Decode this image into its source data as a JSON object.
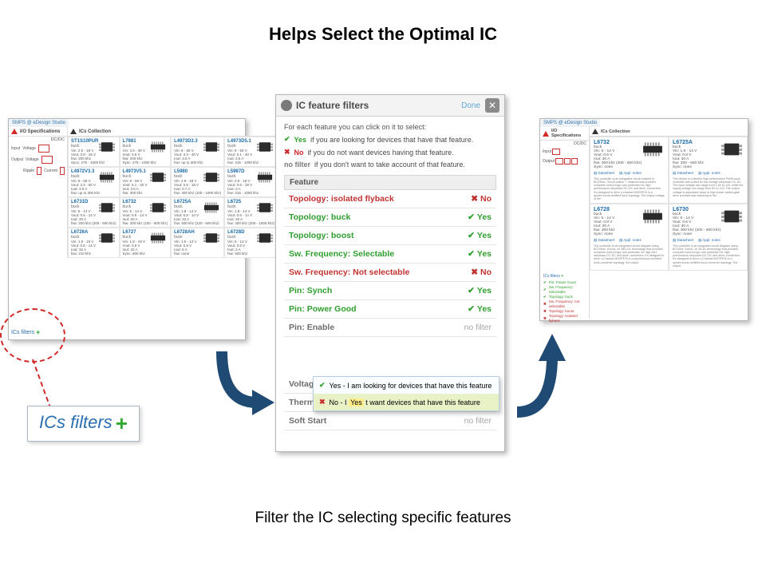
{
  "title": "Helps Select the Optimal IC",
  "subtitle": "Filter the IC selecting specific features",
  "callout_text": "ICs filters",
  "left": {
    "app": "SMPS @ eDesign Studio",
    "io_spec": "I/O Specifications",
    "ics_collection": "ICs Collection",
    "dcdc": "DC/DC",
    "input_lbl": "Input",
    "output_lbl": "Output",
    "voltage": "Voltage",
    "ripple": "Ripple",
    "current": "Current",
    "footer": "ICs filters",
    "cells": [
      {
        "name": "ST1S10PUR",
        "type": "buck",
        "l1": "Vin: 2.5 - 18 V",
        "l2": "Vout: 0.8 - 18 V",
        "l3": "fsw: 200 khz",
        "l4": "Sync: 275 - 1000 khz"
      },
      {
        "name": "L7981",
        "type": "buck",
        "l1": "Vin: 4.5 - 38 V",
        "l2": "Vout: 0.6 V",
        "l3": "fsw: 200 khz",
        "l4": "Sync: 275 - 1000 khz"
      },
      {
        "name": "L4973D3.3",
        "type": "buck",
        "l1": "Vin: 8 - 55 V",
        "l2": "Vout: 3.3 - 40 V",
        "l3": "Iout: 3.5 A",
        "l4": "fsw: up to 300 khz"
      },
      {
        "name": "L4973D5.1",
        "type": "buck",
        "l1": "Vin: 8 - 55 V",
        "l2": "Vout: 5.1 - 40 V",
        "l3": "Iout: 3.5 A",
        "l4": "fsw: 415 - 1000 khz"
      },
      {
        "name": "L4972V3.3",
        "type": "buck",
        "l1": "Vin: 8 - 55 V",
        "l2": "Vout: 3.3 - 50 V",
        "l3": "Iout: 3.5 A",
        "l4": "fsw: up to 300 khz"
      },
      {
        "name": "L4973V5.1",
        "type": "buck",
        "l1": "Vin: 8 - 55 V",
        "l2": "Vout: 5.1 - 40 V",
        "l3": "Iout: 3.5 A",
        "l4": "fsw: 300 khz"
      },
      {
        "name": "L5980",
        "type": "buck",
        "l1": "Vin: 2.9 - 18 V",
        "l2": "Vout: 0.6 - 18 V",
        "l3": "Iout: 0.7 A",
        "l4": "fsw: 400 khz (100 - 1000 khz)"
      },
      {
        "name": "L5987D",
        "type": "buck",
        "l1": "Vin: 2.9 - 18 V",
        "l2": "Vout: 0.6 - 18 V",
        "l3": "Iout: 3 A",
        "l4": "fsw: 415 - 1000 khz"
      },
      {
        "name": "L6731D",
        "type": "buck",
        "l1": "Vin: 5 - 14 V",
        "l2": "Vout: 0.6 - 14 V",
        "l3": "Iout: 20 A",
        "l4": "fsw: 200 khz (200 - 600 khz)"
      },
      {
        "name": "L6732",
        "type": "buck",
        "l1": "Vin: 5 - 14 V",
        "l2": "Vout: 0.6 - 14 V",
        "l3": "Iout: 20 A",
        "l4": "fsw: 300 khz (100 - 600 khz)"
      },
      {
        "name": "L6725A",
        "type": "buck",
        "l1": "Vin: 1.8 - 14 V",
        "l2": "Vout: 0.8 - 14 V",
        "l3": "Iout: 32 A",
        "l4": "fsw: 600 khz (220 - 600 khz)"
      },
      {
        "name": "L6725",
        "type": "buck",
        "l1": "Vin: 1.8 - 14 V",
        "l2": "Vout: 0.6 - 14 V",
        "l3": "Iout: 32 A",
        "l4": "fsw: 400 khz (200 - 1000 khz)"
      },
      {
        "name": "L6726A",
        "type": "buck",
        "l1": "Vin: 1.8 - 19 V",
        "l2": "Vout: 0.6 - 14 V",
        "l3": "Iout: 32 A",
        "l4": "fsw: 210 khz"
      },
      {
        "name": "L6727",
        "type": "buck",
        "l1": "Vin: 1.8 - 19 V",
        "l2": "Vout: 0.6 V",
        "l3": "Iout: 32 A",
        "l4": "Sync: 600 khz"
      },
      {
        "name": "L6728AH",
        "type": "buck",
        "l1": "Vin: 1.5 - 13 V",
        "l2": "Vout: 0.8 V",
        "l3": "Iout: 5 A",
        "l4": "fsw: none"
      },
      {
        "name": "L6728D",
        "type": "buck",
        "l1": "Vin: 5 - 13 V",
        "l2": "Vout: 0.8 V",
        "l3": "Iout: 2 A",
        "l4": "fsw: 500 khz"
      }
    ]
  },
  "center": {
    "title": "IC feature filters",
    "done": "Done",
    "intro": "For each feature you can click on it to select:",
    "leg_yes_pre": "Yes",
    "leg_yes": "if you are looking for devices that have that feature.",
    "leg_no_pre": "No",
    "leg_no": "if you do not want devices having that feature.",
    "leg_nf_pre": "no filter",
    "leg_nf": "if you don't want to take account of that feature.",
    "feature_hdr": "Feature",
    "rows": [
      {
        "name": "Topology: isolated flyback",
        "state": "No"
      },
      {
        "name": "Topology: buck",
        "state": "Yes"
      },
      {
        "name": "Topology: boost",
        "state": "Yes"
      },
      {
        "name": "Sw. Frequency: Selectable",
        "state": "Yes"
      },
      {
        "name": "Sw. Frequency: Not selectable",
        "state": "No"
      },
      {
        "name": "Pin: Synch",
        "state": "Yes"
      },
      {
        "name": "Pin: Power Good",
        "state": "Yes"
      },
      {
        "name": "Pin: Enable",
        "state": "no filter"
      },
      {
        "name": "Voltage feed-forward",
        "state": "no filter"
      },
      {
        "name": "Thermal shutdown",
        "state": "no filter"
      },
      {
        "name": "Soft Start",
        "state": "no filter"
      }
    ],
    "popover_yes": "Yes - I am looking for devices that have this feature",
    "popover_no_pre": "No - I",
    "popover_no_hl": "Yes",
    "popover_no_post": "t want devices that have this feature"
  },
  "right": {
    "app": "SMPS @ eDesign Studio",
    "io_spec": "I/O Specifications",
    "ics_collection": "ICs Collection",
    "dcdc": "DC/DC",
    "cells": [
      {
        "name": "L6732",
        "l1": "buck",
        "l2": "Vin: 5 - 14 V",
        "l3": "Vout: 0.6 V",
        "l4": "Iout: 30 A",
        "l5": "fsw: 300 khz (200 - 600 khz)",
        "l6": "Sync: none",
        "desc": "This controller is an integrated circuit realized in BCD5xxx, SxxxA soltion +; features that provides complete control logic and protection for high performance stepdown DC-DC and drive; converters. It's designed to drive n-channel MOSFETs in a synchronous-rectified buck topology. The output voltage of the"
      },
      {
        "name": "L6725A",
        "l1": "buck",
        "l2": "Vin: 1.8 - 14 V",
        "l3": "Vout: 0.8 V",
        "l4": "Iout: 30 A",
        "l5": "fsw: 200 - 600 khz",
        "l6": "Sync: none",
        "desc": "This device is a flexible high performance PWM-buck controller well-suited for low voltage stepdown DC-DC. The input voltage can range from 1.8V to 14V, while the supply voltage can range from 5V to 12V. The output voltage is adjustable down to high power switch-gate drive provides fast switching to the"
      },
      {
        "name": "L6728",
        "l1": "buck",
        "l2": "Vin: 5 - 14 V",
        "l3": "Vout: 0.8 V",
        "l4": "Iout: 30 A",
        "l5": "fsw: 300 khz",
        "l6": "Sync: none",
        "desc": "The controller is an integrated circuit diagram using BCD5xxx. ExxxA, ch 2BG-DL technology that provides complete control logic and protection for high perf. stepdown DC-DC and drive; converters; it's designed to drive n-Channel MOSFETs in a synchronous-rectified buck-converter topology; the output"
      },
      {
        "name": "L6730",
        "l1": "buck",
        "l2": "Vin: 5 - 14 V",
        "l3": "Vout: 0.6 V",
        "l4": "Iout: 30 A",
        "l5": "fsw: 300 khz (200 - 600 khz)",
        "l6": "Sync: none",
        "desc": "The controller is an integrated circuit diagram using BCD5xx. SxxxA, ch 2B-DL technology that provides complete control logic and protection for high performance stepdown DC-DC and drive; converters. It's designed to drive n-Channel MOSFETs in a synchronous-rectified buck-converter topology. The output"
      }
    ],
    "dl": "Datasheet",
    "an": "Appl. notes",
    "legend_title": "ICs filters",
    "legend": [
      {
        "c": "#2e9e2e",
        "t": "Pin: Power Good"
      },
      {
        "c": "#2e9e2e",
        "t": "Sw. Frequency: Selectable"
      },
      {
        "c": "#2e9e2e",
        "t": "Topology: buck"
      },
      {
        "c": "#c23333",
        "t": "Sw. Frequency: not selectable"
      },
      {
        "c": "#c23333",
        "t": "Topology: boost"
      },
      {
        "c": "#c23333",
        "t": "Topology: isolated flyback"
      }
    ]
  }
}
